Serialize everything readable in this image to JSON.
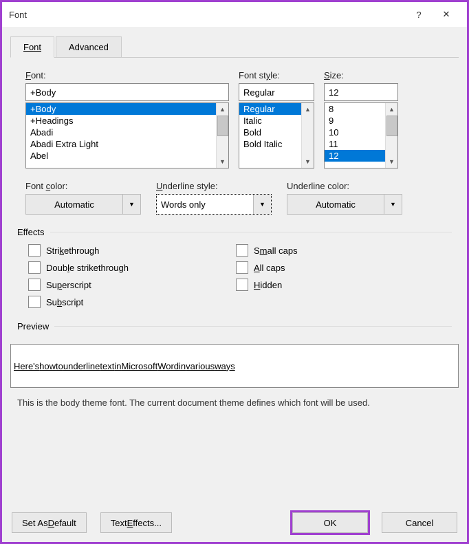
{
  "titlebar": {
    "title": "Font",
    "help": "?",
    "close": "✕"
  },
  "tabs": {
    "font": "Font",
    "advanced": "Advanced"
  },
  "labels": {
    "font": "Font:",
    "fontstyle": "Font style:",
    "size": "Size:",
    "fontcolor": "Font color:",
    "underlinestyle": "Underline style:",
    "underlinecolor": "Underline color:",
    "effects": "Effects",
    "preview": "Preview"
  },
  "font": {
    "value": "+Body",
    "items": [
      "+Body",
      "+Headings",
      "Abadi",
      "Abadi Extra Light",
      "Abel"
    ],
    "selectedIndex": 0
  },
  "style": {
    "value": "Regular",
    "items": [
      "Regular",
      "Italic",
      "Bold",
      "Bold Italic"
    ],
    "selectedIndex": 0
  },
  "size": {
    "value": "12",
    "items": [
      "8",
      "9",
      "10",
      "11",
      "12"
    ],
    "selectedIndex": 4
  },
  "fontcolor": {
    "value": "Automatic"
  },
  "underlinestyle": {
    "value": "Words only"
  },
  "underlinecolor": {
    "value": "Automatic"
  },
  "effects": {
    "strikethrough": "Strikethrough",
    "doublestrike": "Double strikethrough",
    "superscript": "Superscript",
    "subscript": "Subscript",
    "smallcaps": "Small caps",
    "allcaps": "All caps",
    "hidden": "Hidden"
  },
  "preview": {
    "words": [
      "Here's",
      "how",
      "to",
      "underline",
      "text",
      "in",
      "Microsoft",
      "Word",
      "in",
      "various",
      "ways"
    ],
    "desc": "This is the body theme font. The current document theme defines which font will be used."
  },
  "buttons": {
    "setdefault": "Set As Default",
    "texteffects": "Text Effects...",
    "ok": "OK",
    "cancel": "Cancel"
  }
}
